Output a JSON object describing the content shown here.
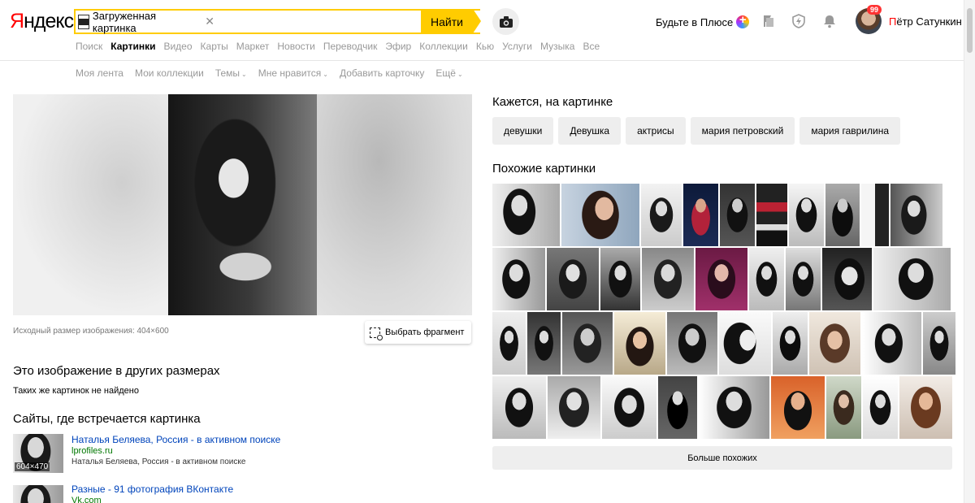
{
  "header": {
    "logo_first": "Я",
    "logo_rest": "ндекс",
    "search_chip_text": "Загруженная картинка",
    "search_button": "Найти",
    "plus_link": "Будьте в Плюсе",
    "notifications_badge": "99",
    "user_first": "П",
    "user_rest": "ётр Сатункин"
  },
  "services": [
    {
      "label": "Поиск",
      "active": false
    },
    {
      "label": "Картинки",
      "active": true
    },
    {
      "label": "Видео",
      "active": false
    },
    {
      "label": "Карты",
      "active": false
    },
    {
      "label": "Маркет",
      "active": false
    },
    {
      "label": "Новости",
      "active": false
    },
    {
      "label": "Переводчик",
      "active": false
    },
    {
      "label": "Эфир",
      "active": false
    },
    {
      "label": "Коллекции",
      "active": false
    },
    {
      "label": "Кью",
      "active": false
    },
    {
      "label": "Услуги",
      "active": false
    },
    {
      "label": "Музыка",
      "active": false
    },
    {
      "label": "Все",
      "active": false
    }
  ],
  "subnav": [
    {
      "label": "Моя лента",
      "dropdown": false
    },
    {
      "label": "Мои коллекции",
      "dropdown": false
    },
    {
      "label": "Темы",
      "dropdown": true
    },
    {
      "label": "Мне нравится",
      "dropdown": true
    },
    {
      "label": "Добавить карточку",
      "dropdown": false
    },
    {
      "label": "Ещё",
      "dropdown": true
    }
  ],
  "main": {
    "image_info": "Исходный размер изображения: 404×600",
    "fragment_button": "Выбрать фрагмент",
    "other_sizes_heading": "Это изображение в других размерах",
    "no_match_text": "Таких же картинок не найдено",
    "sites_heading": "Сайты, где встречается картинка",
    "sites": [
      {
        "title": "Наталья Беляева, Россия - в активном поиске",
        "domain": "lprofiles.ru",
        "desc": "Наталья Беляева, Россия - в активном поиске",
        "size": "604×470"
      },
      {
        "title": "Разные - 91 фотография ВКонтакте",
        "domain": "Vk.com",
        "desc": "",
        "size": ""
      }
    ]
  },
  "right": {
    "tags_heading": "Кажется, на картинке",
    "tags": [
      "девушки",
      "Девушка",
      "актрисы",
      "мария петровский",
      "мария гаврилина"
    ],
    "similar_heading": "Похожие картинки",
    "more_button": "Больше похожих"
  },
  "colors": {
    "accent_yellow": "#ffcc00",
    "logo_red": "#ff0000",
    "link_blue": "#0044bb",
    "domain_green": "#007700"
  },
  "icons": [
    "camera-icon",
    "bookmark-icon",
    "shield-bolt-icon",
    "bell-icon",
    "fragment-select-icon",
    "close-icon",
    "chevron-down-icon"
  ]
}
